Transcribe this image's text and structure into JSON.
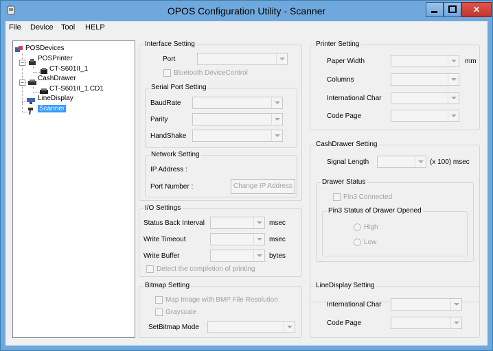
{
  "window": {
    "title": "OPOS Configuration Utility -  Scanner"
  },
  "menu": [
    "File",
    "Device",
    "Tool",
    "HELP"
  ],
  "tree": {
    "root": "POSDevices",
    "printer": "POSPrinter",
    "printer_child": "CT-S601II_1",
    "drawer": "CashDrawer",
    "drawer_child": "CT-S601II_1.CD1",
    "line_display": "LineDisplay",
    "scanner": "Scanner"
  },
  "interface": {
    "title": "Interface Setting",
    "port": "Port",
    "bluetooth": "Bluetooth DeviceControl",
    "serial_title": "Serial Port Setting",
    "baud": "BaudRate",
    "parity": "Parity",
    "handshake": "HandShake"
  },
  "network": {
    "title": "Network Setting",
    "ip": "IP Address  :",
    "port_number": "Port Number :",
    "change_ip": "Change IP Address"
  },
  "io": {
    "title": "I/O Settings",
    "status_back": "Status Back Interval",
    "write_timeout": "Write Timeout",
    "write_buffer": "Write Buffer",
    "msec1": "msec",
    "msec2": "msec",
    "bytes": "bytes",
    "detect": "Detect the completion of printing"
  },
  "bitmap": {
    "title": "Bitmap Setting",
    "map_image": "Map Image with BMP File Resolution",
    "grayscale": "Grayscale",
    "mode": "SetBitmap Mode"
  },
  "printer": {
    "title": "Printer Setting",
    "paper_width": "Paper Width",
    "mm": "mm",
    "columns": "Columns",
    "intl": "International Char",
    "code_page": "Code Page"
  },
  "drawer": {
    "title": "CashDrawer Setting",
    "signal_length": "Signal Length",
    "unit": "(x 100) msec",
    "status_title": "Drawer Status",
    "pin3_connected": "Pin3 Connected",
    "pin3_status_title": "Pin3 Status of Drawer Opened",
    "high": "High",
    "low": "Low"
  },
  "line_display": {
    "title": "LineDisplay Setting",
    "intl": "International Char",
    "code_page": "Code Page"
  },
  "colors": {
    "titlebar": "#6fa8dc",
    "selection": "#3399ff",
    "panel": "#f0f0f0"
  }
}
